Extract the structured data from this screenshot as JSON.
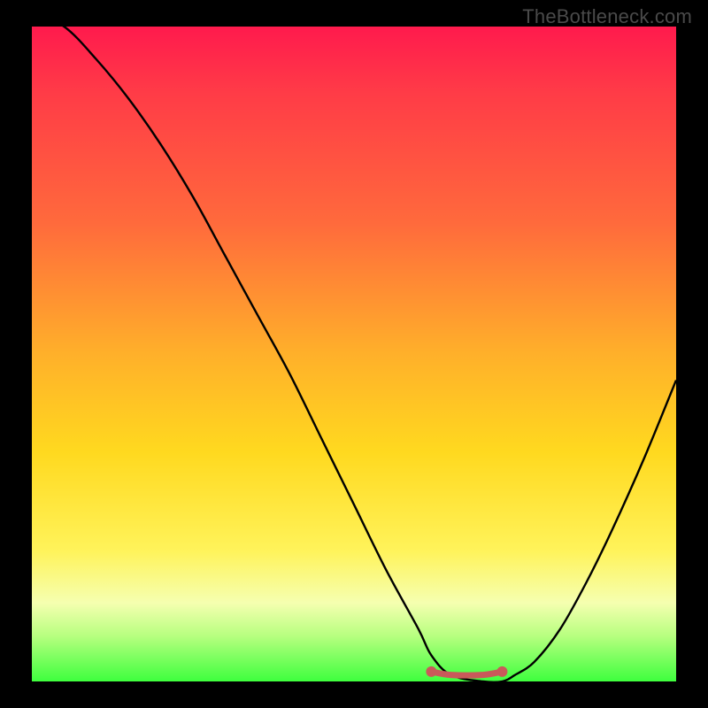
{
  "watermark": "TheBottleneck.com",
  "chart_data": {
    "type": "line",
    "title": "",
    "xlabel": "",
    "ylabel": "",
    "xlim": [
      0,
      100
    ],
    "ylim": [
      0,
      100
    ],
    "series": [
      {
        "name": "bottleneck-curve",
        "x": [
          0,
          5,
          10,
          15,
          20,
          25,
          30,
          35,
          40,
          45,
          50,
          55,
          60,
          62,
          65,
          70,
          73,
          75,
          78,
          82,
          86,
          90,
          95,
          100
        ],
        "values": [
          102,
          100,
          95,
          89,
          82,
          74,
          65,
          56,
          47,
          37,
          27,
          17,
          8,
          4,
          1,
          0,
          0,
          1,
          3,
          8,
          15,
          23,
          34,
          46
        ]
      },
      {
        "name": "flat-min-segment",
        "x": [
          62,
          65,
          70,
          73
        ],
        "values": [
          1.5,
          1,
          1,
          1.5
        ]
      }
    ],
    "colors": {
      "curve_stroke": "#000000",
      "flat_segment": "#c95a5a",
      "segment_endpoints": "#c95a5a"
    }
  }
}
